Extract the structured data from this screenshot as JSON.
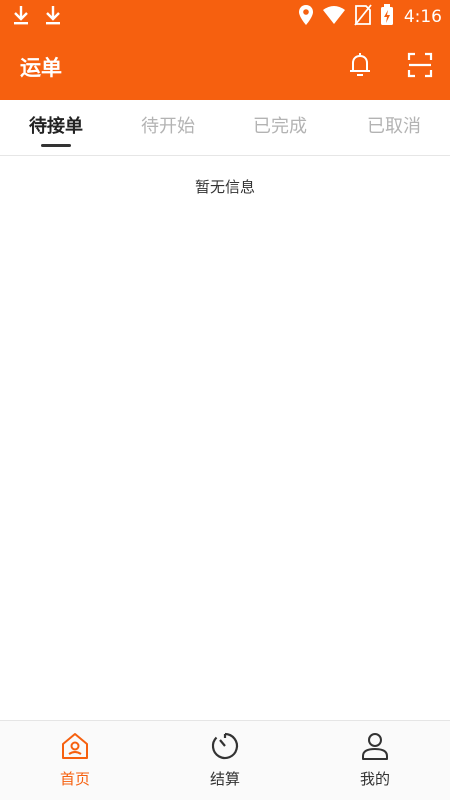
{
  "status_bar": {
    "time": "4:16",
    "left_icons": [
      "download-icon",
      "download-icon"
    ],
    "right_icons": [
      "location-icon",
      "wifi-icon",
      "no-sim-icon",
      "battery-charging-icon"
    ]
  },
  "app_bar": {
    "title": "运单",
    "actions": [
      "bell-icon",
      "scan-icon"
    ],
    "background_color": "#f6600f"
  },
  "tabs": {
    "items": [
      {
        "label": "待接单",
        "active": true
      },
      {
        "label": "待开始",
        "active": false
      },
      {
        "label": "已完成",
        "active": false
      },
      {
        "label": "已取消",
        "active": false
      }
    ]
  },
  "content": {
    "empty_text": "暂无信息"
  },
  "bottom_nav": {
    "items": [
      {
        "label": "首页",
        "icon": "home-icon",
        "active": true
      },
      {
        "label": "结算",
        "icon": "timer-icon",
        "active": false
      },
      {
        "label": "我的",
        "icon": "user-icon",
        "active": false
      }
    ],
    "accent_color": "#f6600f"
  }
}
